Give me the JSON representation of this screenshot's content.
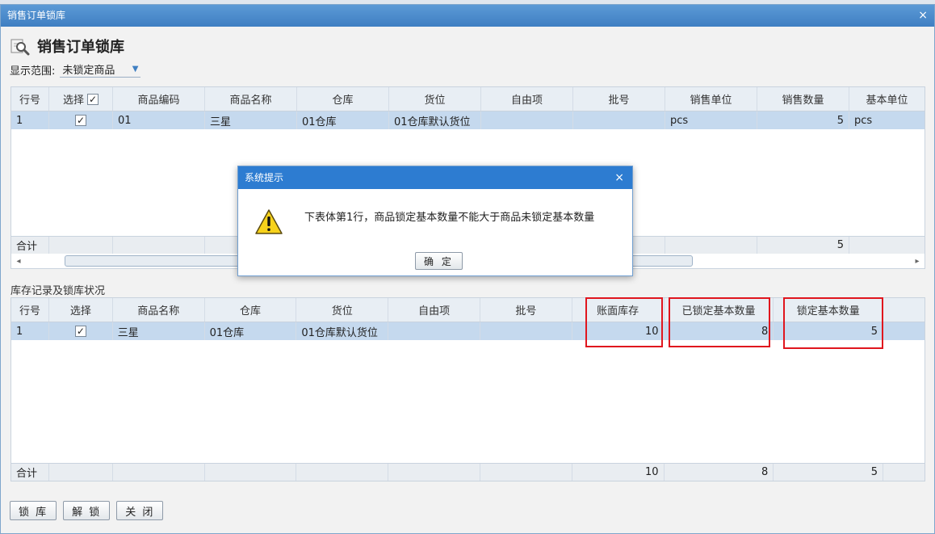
{
  "window": {
    "title": "销售订单锁库"
  },
  "header": {
    "title": "销售订单锁库"
  },
  "filter": {
    "label": "显示范围:",
    "selected": "未锁定商品"
  },
  "top_grid": {
    "columns": [
      "行号",
      "选择",
      "商品编码",
      "商品名称",
      "仓库",
      "货位",
      "自由项",
      "批号",
      "销售单位",
      "销售数量",
      "基本单位"
    ],
    "rows": [
      {
        "line": "1",
        "checked": "✓",
        "code": "01",
        "name": "三星",
        "warehouse": "01仓库",
        "location": "01仓库默认货位",
        "free": "",
        "batch": "",
        "sale_unit": "pcs",
        "sale_qty": "5",
        "base_unit": "pcs"
      }
    ],
    "total_label": "合计",
    "total_sale_qty": "5"
  },
  "bottom_section": {
    "label": "库存记录及锁库状况"
  },
  "bottom_grid": {
    "columns": [
      "行号",
      "选择",
      "商品名称",
      "仓库",
      "货位",
      "自由项",
      "批号",
      "账面库存",
      "已锁定基本数量",
      "锁定基本数量"
    ],
    "rows": [
      {
        "line": "1",
        "checked": "✓",
        "name": "三星",
        "warehouse": "01仓库",
        "location": "01仓库默认货位",
        "free": "",
        "batch": "",
        "book_stock": "10",
        "locked_qty": "8",
        "lock_qty": "5"
      }
    ],
    "total_label": "合计",
    "total_book_stock": "10",
    "total_locked_qty": "8",
    "total_lock_qty": "5"
  },
  "buttons": {
    "lock": "锁 库",
    "unlock": "解 锁",
    "close": "关 闭"
  },
  "dialog": {
    "title": "系统提示",
    "message": "下表体第1行，商品锁定基本数量不能大于商品未锁定基本数量",
    "ok": "确 定"
  },
  "colors": {
    "title_bar": "#3f7fc2",
    "dialog_title": "#2d7cd1",
    "selected_row": "#c5d9ee",
    "highlight": "#e0161e"
  },
  "icons": {
    "window_close": "close-icon",
    "header": "magnifier-icon",
    "dialog": "warning-icon"
  }
}
